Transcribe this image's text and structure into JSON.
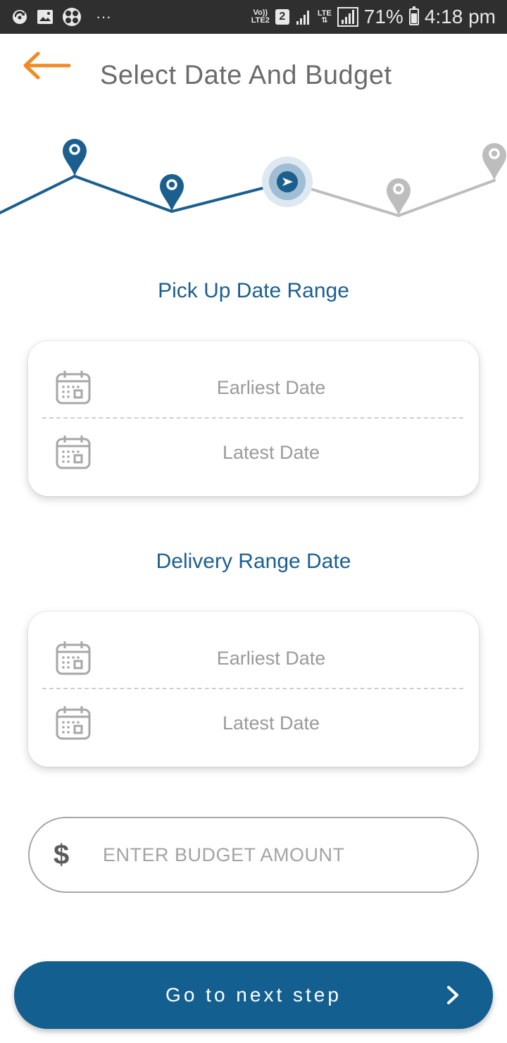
{
  "status_bar": {
    "volte_top": "Vo))",
    "volte_bottom": "LTE2",
    "sim_slot": "2",
    "lte_label": "LTE",
    "battery_percent": "71%",
    "battery_level": 0.71,
    "time": "4:18 pm",
    "overflow": "···"
  },
  "header": {
    "title": "Select Date And Budget",
    "back_icon": "arrow-left-icon",
    "accent_color": "#f08a24"
  },
  "progress": {
    "total_steps": 5,
    "completed_steps": 2,
    "current_step": 3,
    "active_color": "#1c5f8e",
    "inactive_color": "#bdbdbd"
  },
  "pickup": {
    "title": "Pick Up Date Range",
    "earliest_label": "Earliest Date",
    "latest_label": "Latest Date"
  },
  "delivery": {
    "title": "Delivery Range Date",
    "earliest_label": "Earliest Date",
    "latest_label": "Latest Date"
  },
  "budget": {
    "currency_symbol": "$",
    "placeholder": "ENTER BUDGET AMOUNT",
    "value": ""
  },
  "next_button": {
    "label": "Go to next step",
    "color": "#135f8f"
  }
}
